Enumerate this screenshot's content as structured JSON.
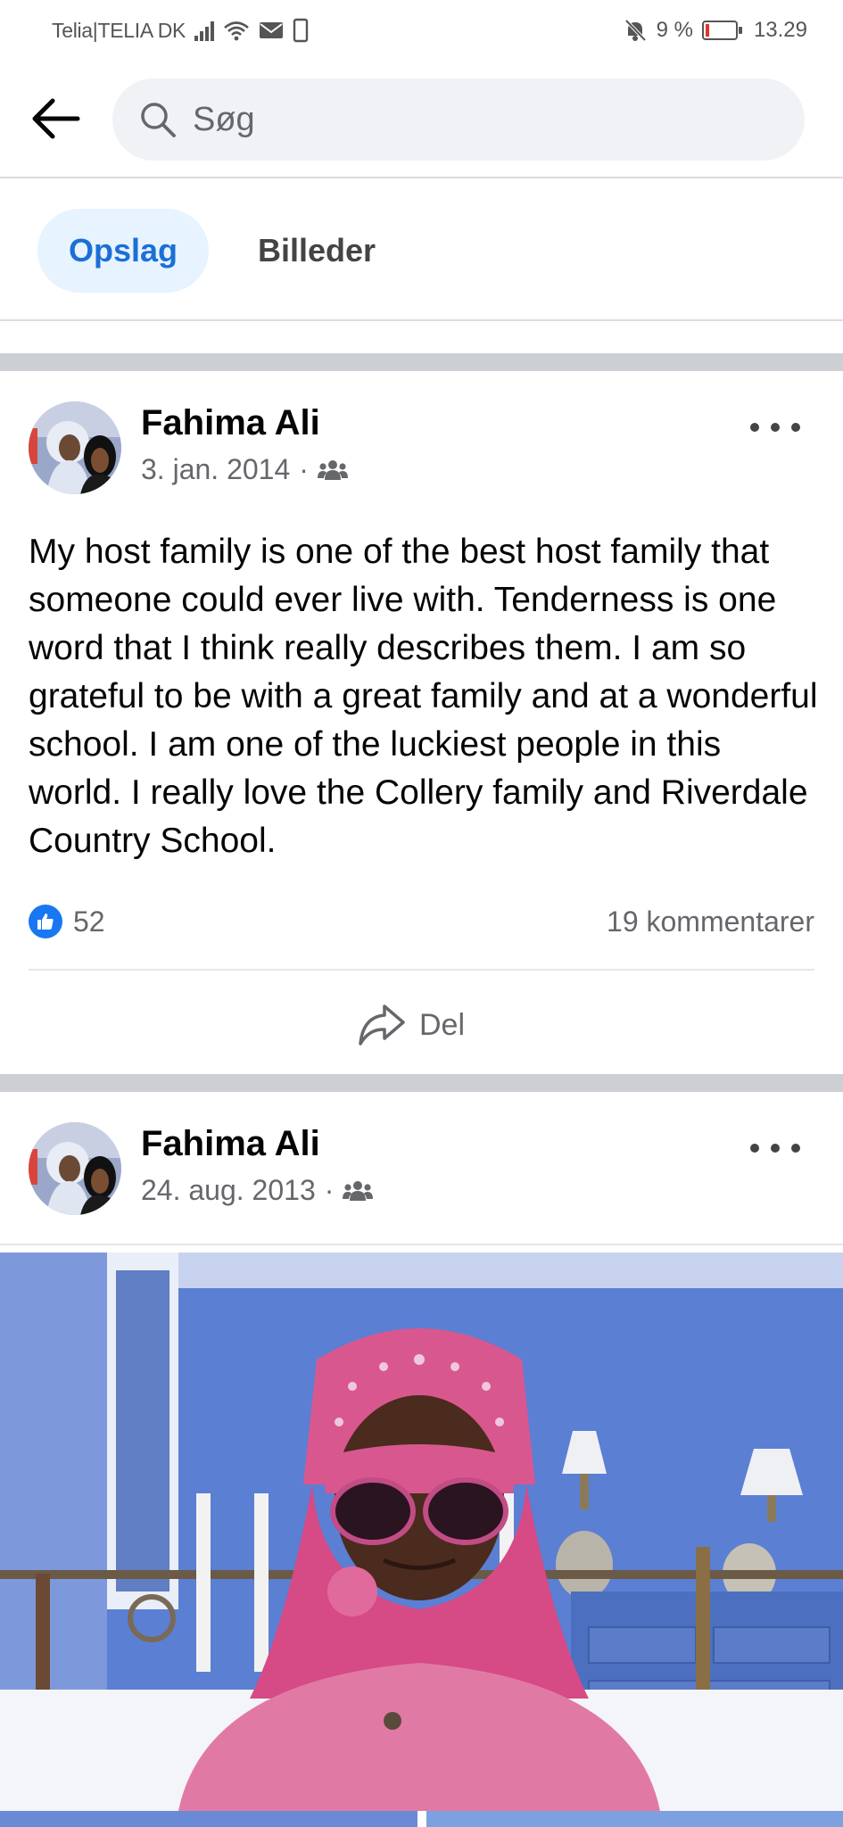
{
  "status_bar": {
    "carrier": "Telia|TELIA DK",
    "battery": "9 %",
    "time": "13.29",
    "icons": [
      "signal-icon",
      "wifi-icon",
      "mail-icon",
      "sim-icon",
      "bell-off-icon",
      "battery-icon"
    ]
  },
  "search": {
    "placeholder": "Søg"
  },
  "tabs": [
    {
      "label": "Opslag",
      "active": true
    },
    {
      "label": "Billeder",
      "active": false
    }
  ],
  "posts": [
    {
      "author": "Fahima Ali",
      "date": "3. jan. 2014",
      "separator": "·",
      "audience_icon": "friends-icon",
      "text": "My host family is one of the best host family that someone could ever live with. Tenderness is one word that I think really describes them. I am so grateful to be with a great family and at a wonderful school. I am one of the luckiest people in this world. I really love the Collery family and Riverdale Country School.",
      "likes": "52",
      "comments": "19 kommentarer",
      "share_label": "Del"
    },
    {
      "author": "Fahima Ali",
      "date": "24. aug. 2013",
      "separator": "·",
      "audience_icon": "friends-icon"
    }
  ],
  "colors": {
    "accent": "#1b6fd6",
    "like_blue": "#1877f2",
    "tab_active_bg": "#e7f3ff",
    "divider": "#ccd0d5",
    "battery_low": "#e0342b"
  }
}
